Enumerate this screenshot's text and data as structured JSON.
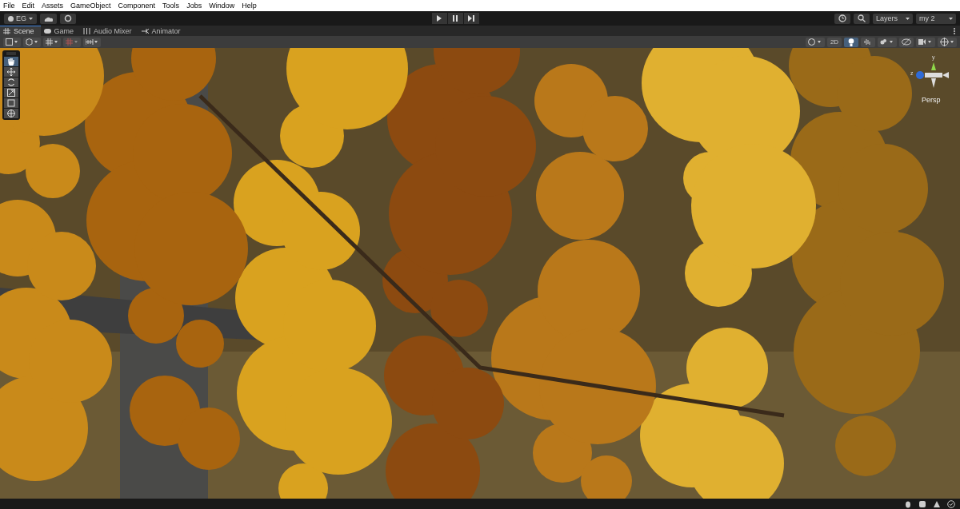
{
  "menu": [
    "File",
    "Edit",
    "Assets",
    "GameObject",
    "Component",
    "Tools",
    "Jobs",
    "Window",
    "Help"
  ],
  "toolbar": {
    "account": "EG",
    "layers": "Layers",
    "layout": "my 2"
  },
  "tabs": [
    {
      "label": "Scene",
      "kind": "scene",
      "selected": true
    },
    {
      "label": "Game",
      "kind": "game",
      "selected": false
    },
    {
      "label": "Audio Mixer",
      "kind": "mixer",
      "selected": false
    },
    {
      "label": "Animator",
      "kind": "animator",
      "selected": false
    }
  ],
  "scene_toolbar": {
    "mode_2d": {
      "label": "2D",
      "on": false
    },
    "lighting": {
      "on": true
    },
    "audio": {
      "on": false
    },
    "hidden_objects": {
      "on": false
    }
  },
  "tools": [
    {
      "kind": "hand",
      "selected": true
    },
    {
      "kind": "move",
      "selected": false
    },
    {
      "kind": "rotate",
      "selected": false
    },
    {
      "kind": "scale",
      "selected": false
    },
    {
      "kind": "rect",
      "selected": false
    },
    {
      "kind": "transform",
      "selected": false
    }
  ],
  "gizmo": {
    "y_axis": "y",
    "z_axis": "z",
    "projection": "Persp"
  }
}
